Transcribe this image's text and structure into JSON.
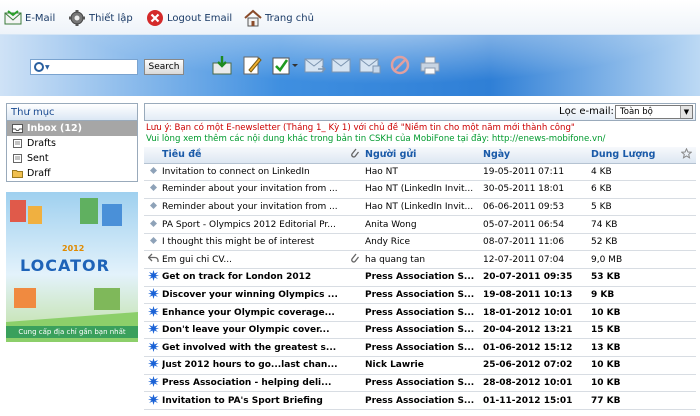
{
  "nav": {
    "email": "E-Mail",
    "settings": "Thiết lập",
    "logout": "Logout Email",
    "home": "Trang chủ"
  },
  "search": {
    "value": "",
    "button": "Search"
  },
  "folders": {
    "header": "Thư mục",
    "items": [
      {
        "label": "Inbox (12)"
      },
      {
        "label": "Drafts"
      },
      {
        "label": "Sent"
      },
      {
        "label": "Draff"
      }
    ]
  },
  "ad": {
    "logo": "LOCATOR",
    "year": "2012",
    "tagline": "Cung cấp địa chỉ gần bạn nhất"
  },
  "filter": {
    "label": "Lọc e-mail:",
    "selected": "Toàn bộ"
  },
  "notices": {
    "line1": "Lưu ý: Bạn có một E-newsletter (Tháng 1_ Kỳ 1) với chủ đề \"Niềm tin cho một năm mới thành công\"",
    "line2": "Vui lòng xem thêm các nội dung khác trong bản tin CSKH của MobiFone tại đây: http://enews-mobifone.vn/"
  },
  "columns": {
    "subject": "Tiêu đề",
    "sender": "Người gửi",
    "date": "Ngày",
    "size": "Dung Lượng"
  },
  "emails": [
    {
      "status": "read",
      "subject": "Invitation to connect on LinkedIn",
      "attach": false,
      "sender": "Hao NT",
      "date": "19-05-2011 07:11",
      "size": "4 KB"
    },
    {
      "status": "read",
      "subject": "Reminder about your invitation from ...",
      "attach": false,
      "sender": "Hao NT (LinkedIn Invit...",
      "date": "30-05-2011 18:01",
      "size": "6 KB"
    },
    {
      "status": "read",
      "subject": "Reminder about your invitation from ...",
      "attach": false,
      "sender": "Hao NT (LinkedIn Invit...",
      "date": "06-06-2011 09:53",
      "size": "5 KB"
    },
    {
      "status": "read",
      "subject": "PA Sport - Olympics 2012 Editorial Pr...",
      "attach": false,
      "sender": "Anita Wong",
      "date": "05-07-2011 06:54",
      "size": "74 KB"
    },
    {
      "status": "read",
      "subject": "I thought this might be of interest",
      "attach": false,
      "sender": "Andy Rice",
      "date": "08-07-2011 11:06",
      "size": "52 KB"
    },
    {
      "status": "replied",
      "subject": "Em gui chi CV...",
      "attach": true,
      "sender": "ha quang tan",
      "date": "12-07-2011 07:04",
      "size": "9,0 MB"
    },
    {
      "status": "unread",
      "subject": "Get on track for London 2012",
      "attach": false,
      "sender": "Press Association S...",
      "date": "20-07-2011 09:35",
      "size": "53 KB"
    },
    {
      "status": "unread",
      "subject": "Discover your winning Olympics ...",
      "attach": false,
      "sender": "Press Association S...",
      "date": "19-08-2011 10:13",
      "size": "9 KB"
    },
    {
      "status": "unread",
      "subject": "Enhance your Olympic coverage...",
      "attach": false,
      "sender": "Press Association S...",
      "date": "18-01-2012 10:01",
      "size": "10 KB"
    },
    {
      "status": "unread",
      "subject": "Don't leave your Olympic cover...",
      "attach": false,
      "sender": "Press Association S...",
      "date": "20-04-2012 13:21",
      "size": "15 KB"
    },
    {
      "status": "unread",
      "subject": "Get involved with the greatest s...",
      "attach": false,
      "sender": "Press Association S...",
      "date": "01-06-2012 15:12",
      "size": "13 KB"
    },
    {
      "status": "unread",
      "subject": "Just 2012 hours to go...last chan...",
      "attach": false,
      "sender": "Nick Lawrie",
      "date": "25-06-2012 07:02",
      "size": "10 KB"
    },
    {
      "status": "unread",
      "subject": "Press Association - helping deli...",
      "attach": false,
      "sender": "Press Association S...",
      "date": "28-08-2012 10:01",
      "size": "10 KB"
    },
    {
      "status": "unread",
      "subject": "Invitation to PA's Sport Briefing",
      "attach": false,
      "sender": "Press Association S...",
      "date": "01-11-2012 15:01",
      "size": "77 KB"
    }
  ]
}
